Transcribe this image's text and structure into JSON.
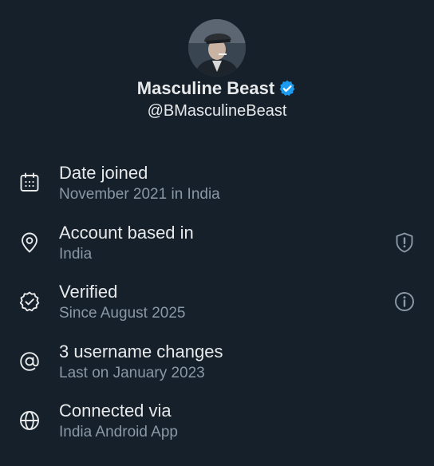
{
  "profile": {
    "display_name": "Masculine Beast",
    "handle": "@BMasculineBeast",
    "verified_badge_color": "#1d9bf0"
  },
  "colors": {
    "background": "#15202b",
    "primary_text": "#e7e9ea",
    "secondary_text": "#8b98a5"
  },
  "info": [
    {
      "title": "Date joined",
      "subtitle": "November 2021 in India",
      "icon": "calendar-icon",
      "action_icon": null
    },
    {
      "title": "Account based in",
      "subtitle": "India",
      "icon": "location-pin-icon",
      "action_icon": "shield-exclamation-icon"
    },
    {
      "title": "Verified",
      "subtitle": "Since August 2025",
      "icon": "verified-check-icon",
      "action_icon": "info-icon"
    },
    {
      "title": "3 username changes",
      "subtitle": "Last on January 2023",
      "icon": "at-sign-icon",
      "action_icon": null
    },
    {
      "title": "Connected via",
      "subtitle": "India Android App",
      "icon": "globe-icon",
      "action_icon": null
    }
  ]
}
